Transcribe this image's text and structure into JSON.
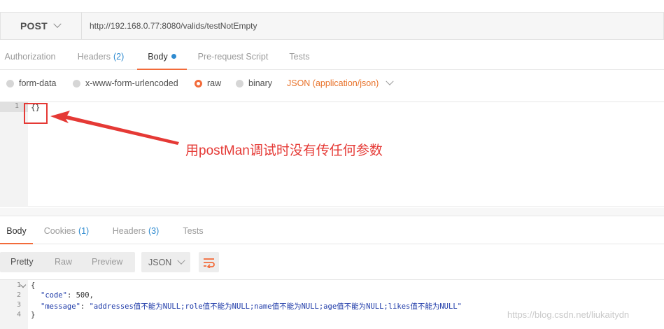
{
  "request": {
    "method": "POST",
    "url": "http://192.168.0.77:8080/valids/testNotEmpty"
  },
  "request_tabs": [
    {
      "label": "Authorization",
      "count": ""
    },
    {
      "label": "Headers",
      "count": "(2)"
    },
    {
      "label": "Body",
      "count": ""
    },
    {
      "label": "Pre-request Script",
      "count": ""
    },
    {
      "label": "Tests",
      "count": ""
    }
  ],
  "body_types": {
    "options": [
      "form-data",
      "x-www-form-urlencoded",
      "raw",
      "binary"
    ],
    "selected": "raw",
    "content_type": "JSON (application/json)"
  },
  "editor": {
    "line_number": "1",
    "content": "{}"
  },
  "annotation": {
    "text": "用postMan调试时没有传任何参数",
    "color": "#e53935"
  },
  "response_tabs": [
    {
      "label": "Body",
      "count": ""
    },
    {
      "label": "Cookies",
      "count": "(1)"
    },
    {
      "label": "Headers",
      "count": "(3)"
    },
    {
      "label": "Tests",
      "count": ""
    }
  ],
  "response_toolbar": {
    "views": [
      "Pretty",
      "Raw",
      "Preview"
    ],
    "selected_view": "Pretty",
    "format": "JSON"
  },
  "response_body": {
    "line_numbers": [
      "1",
      "2",
      "3",
      "4"
    ],
    "open_brace": "{",
    "code_key": "\"code\"",
    "code_value": "500",
    "message_key": "\"message\"",
    "message_value": "\"addresses值不能为NULL;role值不能为NULL;name值不能为NULL;age值不能为NULL;likes值不能为NULL\"",
    "close_brace": "}"
  },
  "watermark": "https://blog.csdn.net/liukaitydn",
  "colors": {
    "accent": "#f26b3a",
    "count_blue": "#2f8bd0"
  }
}
